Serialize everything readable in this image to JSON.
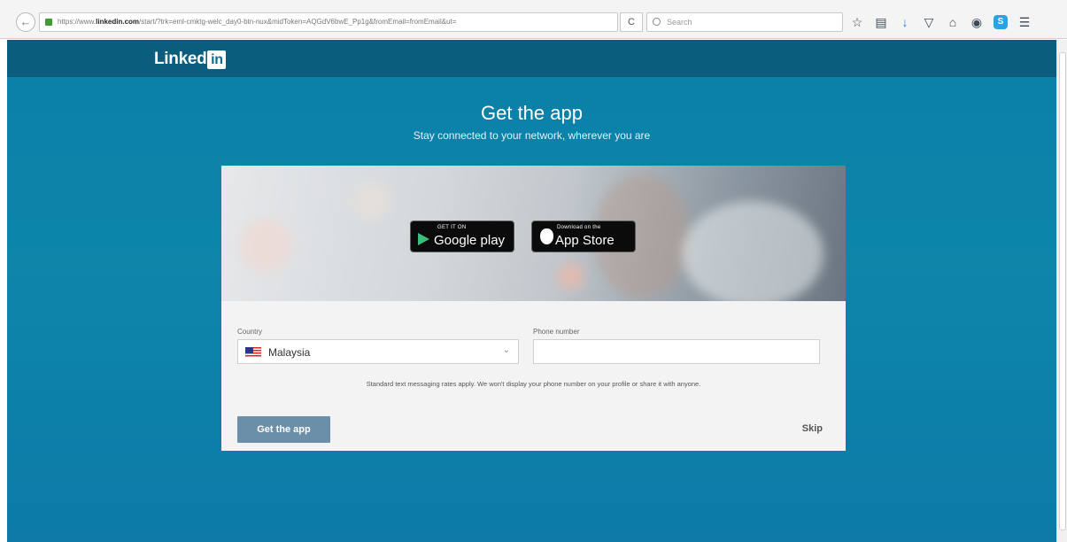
{
  "browser": {
    "url_prefix": "https://www.",
    "url_host": "linkedin.com",
    "url_rest": "/start/?trk=eml-cmktg-welc_day0-btn-nux&midToken=AQGdV6bwE_Pp1g&fromEmail=fromEmail&ut=",
    "reload_label": "C",
    "search_placeholder": "Search"
  },
  "header": {
    "logo_text": "Linked",
    "logo_badge": "in"
  },
  "main": {
    "title": "Get the app",
    "subtitle": "Stay connected to your network, wherever you are"
  },
  "badges": {
    "google_small": "GET IT ON",
    "google_big": "Google play",
    "apple_small": "Download on the",
    "apple_big": "App Store"
  },
  "form": {
    "country_label": "Country",
    "country_value": "Malaysia",
    "phone_label": "Phone number",
    "phone_value": "",
    "disclaimer": "Standard text messaging rates apply. We won't display your phone number on your profile or share it with anyone.",
    "submit_label": "Get the app",
    "skip_label": "Skip"
  },
  "colors": {
    "page_bg": "#0d86aa",
    "top_band": "#0a5d7c",
    "button_bg": "#6b8fa8"
  },
  "icons": [
    "back-arrow-icon",
    "lock-icon",
    "reload-icon",
    "search-icon",
    "star-icon",
    "clipboard-icon",
    "download-icon",
    "pocket-icon",
    "home-icon",
    "chat-icon",
    "skype-icon",
    "menu-icon",
    "google-play-icon",
    "apple-icon",
    "malaysia-flag-icon",
    "chevron-down-icon"
  ]
}
